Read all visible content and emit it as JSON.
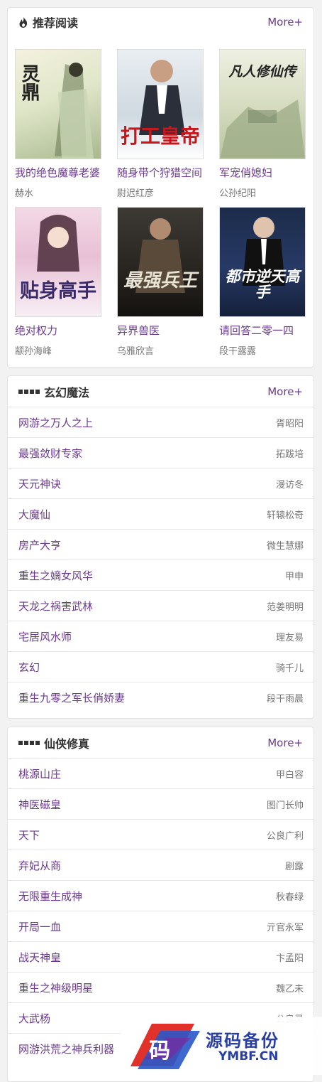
{
  "recommend": {
    "title": "推荐阅读",
    "more": "More+",
    "books": [
      {
        "title": "我的绝色魔尊老婆",
        "author": "赫水",
        "cover_text": "灵鼎"
      },
      {
        "title": "随身带个狩猎空间",
        "author": "尉迟红彦",
        "cover_text": "打工皇帝"
      },
      {
        "title": "军宠俏媳妇",
        "author": "公孙纪阳",
        "cover_text": "凡人修仙传"
      },
      {
        "title": "绝对权力",
        "author": "颛孙海峰",
        "cover_text": "贴身高手"
      },
      {
        "title": "异界兽医",
        "author": "乌雅欣言",
        "cover_text": "最强兵王"
      },
      {
        "title": "请回答二零一四",
        "author": "段干露露",
        "cover_text": "都市逆天高手"
      }
    ]
  },
  "xuanhuan": {
    "title": "玄幻魔法",
    "more": "More+",
    "items": [
      {
        "title": "网游之万人之上",
        "author": "胥昭阳"
      },
      {
        "title": "最强敛财专家",
        "author": "拓跋培"
      },
      {
        "title": "天元神诀",
        "author": "漫访冬"
      },
      {
        "title": "大魔仙",
        "author": "轩辕松奇"
      },
      {
        "title": "房产大亨",
        "author": "微生慧娜"
      },
      {
        "title": "重生之嫡女风华",
        "author": "甲申"
      },
      {
        "title": "天龙之祸害武林",
        "author": "范姜明明"
      },
      {
        "title": "宅居风水师",
        "author": "理友易"
      },
      {
        "title": "玄幻",
        "author": "骑千儿"
      },
      {
        "title": "重生九零之军长俏娇妻",
        "author": "段干雨晨"
      }
    ]
  },
  "xianxia": {
    "title": "仙侠修真",
    "more": "More+",
    "items": [
      {
        "title": "桃源山庄",
        "author": "甲白容"
      },
      {
        "title": "神医磁皇",
        "author": "图门长帅"
      },
      {
        "title": "天下",
        "author": "公良广利"
      },
      {
        "title": "弃妃从商",
        "author": "剧露"
      },
      {
        "title": "无限重生成神",
        "author": "秋春绿"
      },
      {
        "title": "开局一血",
        "author": "亓官永军"
      },
      {
        "title": "战天神皇",
        "author": "卞孟阳"
      },
      {
        "title": "重生之神级明星",
        "author": "魏乙未"
      },
      {
        "title": "大武杨",
        "author": "公良灵"
      },
      {
        "title": "网游洪荒之神兵利器",
        "author": ""
      }
    ]
  },
  "watermark": {
    "cn": "源码备份",
    "en": "YMBF.CN"
  }
}
